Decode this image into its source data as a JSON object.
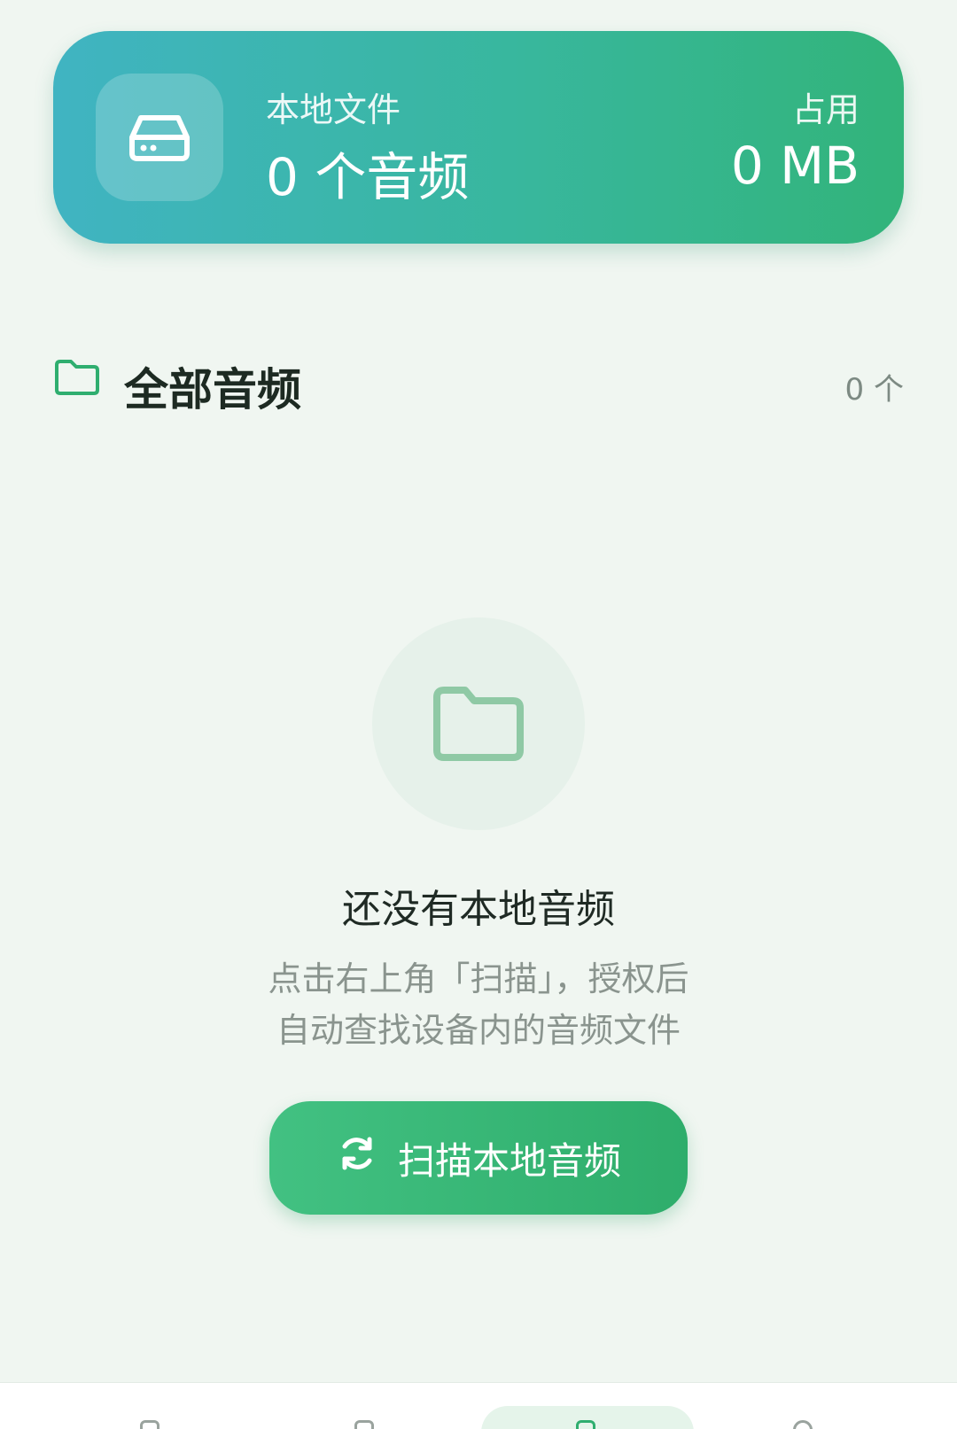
{
  "summary_card": {
    "label": "本地文件",
    "count": "0 个音频",
    "usage_label": "占用",
    "usage_value": "0 MB",
    "icon": "drive-icon"
  },
  "section": {
    "icon": "folder-icon",
    "title": "全部音频",
    "count": "0 个"
  },
  "empty_state": {
    "icon": "folder-icon",
    "title": "还没有本地音频",
    "description_line1": "点击右上角「扫描」，授权后",
    "description_line2": "自动查找设备内的音频文件",
    "button_label": "扫描本地音频",
    "button_icon": "refresh-icon"
  },
  "bottom_nav": {
    "items": [
      "home-icon",
      "explore-icon",
      "library-icon",
      "profile-icon"
    ],
    "active_index": 2
  },
  "colors": {
    "accent": "#32b47a",
    "card_gradient_start": "#40b4c2",
    "background": "#f0f6f1"
  }
}
